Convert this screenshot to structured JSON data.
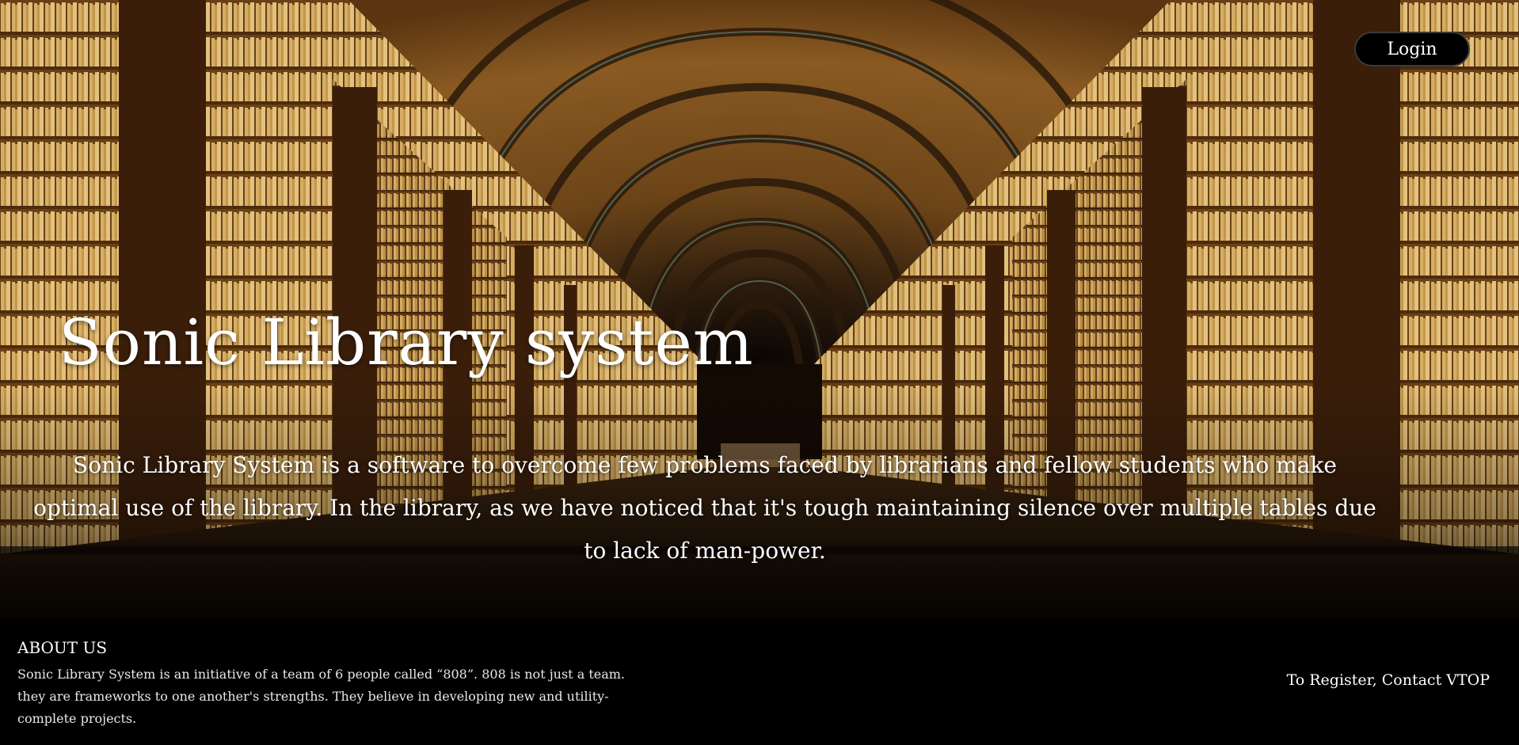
{
  "header": {
    "login_label": "Login"
  },
  "hero": {
    "title": "Sonic Library system",
    "description": "Sonic Library System is a software to overcome few problems faced by librarians and fellow students who make optimal use of the library. In the library, as we have noticed that it's tough maintaining silence over multiple tables due to lack of man-power."
  },
  "footer": {
    "about_title": "ABOUT US",
    "about_text": "Sonic Library System is an initiative of a team of 6 people called “808”. 808 is not just a team. they are frameworks to one another's strengths. They believe in developing new and utility-complete projects.",
    "register_text": "To Register, Contact VTOP"
  },
  "colors": {
    "footer_bg": "#000000",
    "button_bg": "#000000",
    "text": "#ffffff"
  }
}
